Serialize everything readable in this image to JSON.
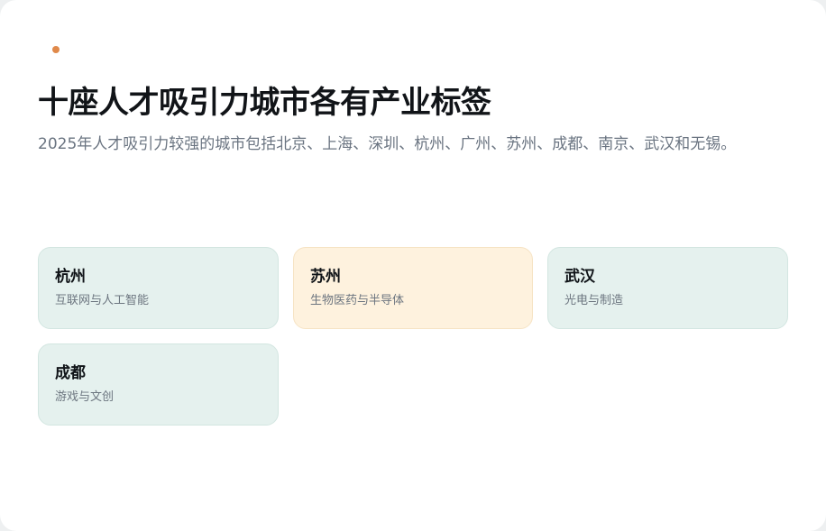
{
  "header": {
    "title": "十座人才吸引力城市各有产业标签",
    "subtitle": "2025年人才吸引力较强的城市包括北京、上海、深圳、杭州、广州、苏州、成都、南京、武汉和无锡。"
  },
  "colors": {
    "accent_dot": "#e0894a",
    "card_teal": "#e5f1ee",
    "card_amber": "#fef2de"
  },
  "cards": [
    {
      "name": "杭州",
      "tag": "互联网与人工智能",
      "variant": "teal"
    },
    {
      "name": "苏州",
      "tag": "生物医药与半导体",
      "variant": "amber"
    },
    {
      "name": "武汉",
      "tag": "光电与制造",
      "variant": "teal"
    },
    {
      "name": "成都",
      "tag": "游戏与文创",
      "variant": "teal"
    }
  ]
}
